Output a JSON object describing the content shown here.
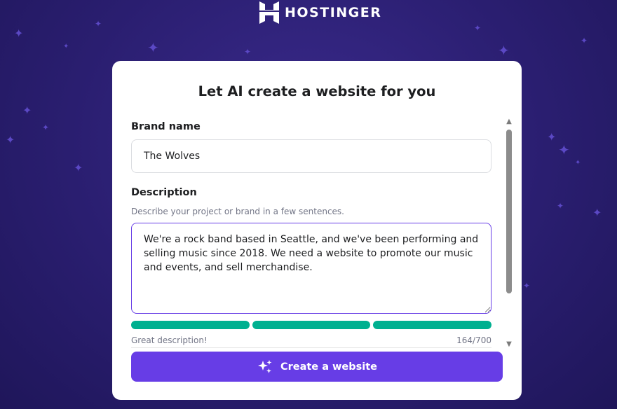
{
  "brand": {
    "name": "HOSTINGER"
  },
  "card": {
    "title": "Let AI create a website for you"
  },
  "form": {
    "brand_name": {
      "label": "Brand name",
      "value": "The Wolves"
    },
    "description": {
      "label": "Description",
      "hint": "Describe your project or brand in a few sentences.",
      "value": "We're a rock band based in Seattle, and we've been performing and selling music since 2018. We need a website to promote our music and events, and sell merchandise.",
      "quality": "Great description!",
      "count": "164/700",
      "strength_segments_filled": 3,
      "strength_segments_total": 3
    }
  },
  "actions": {
    "create_label": "Create a website",
    "create_icon": "sparkles-icon"
  },
  "colors": {
    "accent": "#673de6",
    "progress": "#00b090",
    "background": "#2a1e70"
  }
}
